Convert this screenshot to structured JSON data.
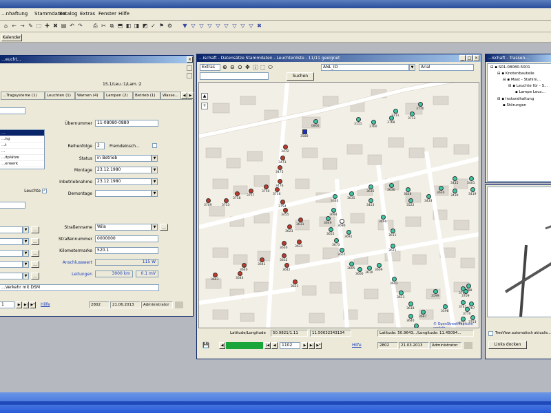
{
  "menu": {
    "items": [
      "...nhaftung",
      "Stammdaten",
      "Katalog",
      "Extras",
      "Fenster",
      "Hilfe"
    ]
  },
  "toolbar2": {
    "label": "Kalender"
  },
  "left_window": {
    "title": "...eucht...",
    "counter": "1S.1/Leu.:1/Lam.:2",
    "tabs": [
      "...Tragsysteme (1)",
      "Leuchten (1)",
      "Warnen (4)",
      "Lampen (2)",
      "Betrieb (1)",
      "Wasse..."
    ],
    "fields": {
      "uebernummer_label": "Übernummer",
      "uebernummer": "11-08080-0880",
      "reihenfolge_label": "Reihenfolge",
      "reihenfolge": "2",
      "fremdeinspeisung_label": "Fremdeinsch...",
      "status_label": "Status",
      "status": "in Betrieb",
      "montage_label": "Montage",
      "montage": "23.12.1980",
      "inbetriebnahme_label": "Inbetriebnahme",
      "inbetriebnahme": "23.12.1980",
      "demontage_label": "Demontage",
      "demontage": "",
      "strassenname_label": "Straßenname",
      "strassenname": "Wila",
      "strassennummer_label": "Straßennummer",
      "strassennummer": "0000000",
      "kilometermarke_label": "Kilometermarke",
      "kilometermarke": "520.1",
      "anschlusswert_label": "Anschlusswert",
      "anschlusswert": "115 W",
      "leitungen_label": "Leitungen",
      "leitungen": "3000 km",
      "leitungen_b": "0.1 mV",
      "checkbox_label": "Leuchte",
      "bottom_text": "...Verkehr mit DSM",
      "small_box": "0"
    },
    "list_items": [
      "...",
      "...ng",
      "...t",
      "...",
      "...itplätze",
      "...erwerk"
    ],
    "status": {
      "page": "1",
      "hilfe": "Hilfe",
      "c1": "2802",
      "c2": "21.06.2013",
      "c3": "Administrator"
    }
  },
  "map_window": {
    "title": "...ischaft - Datensätze Stammdaten - Leuchtenliste - 11/11 geeignet",
    "zoom": "Extras",
    "layer_select": "ANL_ID",
    "font_select": "Arial",
    "search_button": "Suchen",
    "coord_label_1": "Latitude/Longitude",
    "coord_1": "50.9821/1.11",
    "coord_2": "11.50632343134",
    "coord_right": "Latitude: 50.9643.../Longitude: 11.45094...",
    "credit": "© OpenStreetMap.com contrib.",
    "status": {
      "progress": "...",
      "page": "1102",
      "hilfe": "Hilfe",
      "c1": "2802",
      "c2": "21.03.2013",
      "c3": "Administrator"
    },
    "markers": [
      {
        "id": "0806",
        "type": "teal"
      },
      {
        "id": "3151",
        "type": "teal"
      },
      {
        "id": "3760",
        "type": "teal"
      },
      {
        "id": "3768",
        "type": "teal"
      },
      {
        "id": "3711",
        "type": "teal"
      },
      {
        "id": "3712",
        "type": "teal"
      },
      {
        "id": "3770",
        "type": "teal"
      },
      {
        "id": "3580",
        "type": "blue"
      },
      {
        "id": "3472",
        "type": "red"
      },
      {
        "id": "3473",
        "type": "red"
      },
      {
        "id": "3475",
        "type": "red"
      },
      {
        "id": "3476",
        "type": "red"
      },
      {
        "id": "3750",
        "type": "red"
      },
      {
        "id": "3757",
        "type": "red"
      },
      {
        "id": "3758",
        "type": "red"
      },
      {
        "id": "3709",
        "type": "red"
      },
      {
        "id": "3753",
        "type": "red"
      },
      {
        "id": "3756",
        "type": "red"
      },
      {
        "id": "3754",
        "type": "red"
      },
      {
        "id": "3455",
        "type": "red"
      },
      {
        "id": "3623",
        "type": "red"
      },
      {
        "id": "3631",
        "type": "red"
      },
      {
        "id": "3630",
        "type": "red"
      },
      {
        "id": "3631b",
        "type": "red"
      },
      {
        "id": "3632",
        "type": "red"
      },
      {
        "id": "3641",
        "type": "red"
      },
      {
        "id": "3640",
        "type": "red"
      },
      {
        "id": "3643",
        "type": "red"
      },
      {
        "id": "3644",
        "type": "red"
      },
      {
        "id": "3642",
        "type": "red"
      },
      {
        "id": "3621",
        "type": "red"
      },
      {
        "id": "3633",
        "type": "teal"
      },
      {
        "id": "3635",
        "type": "teal"
      },
      {
        "id": "3635b",
        "type": "teal"
      },
      {
        "id": "3636",
        "type": "teal"
      },
      {
        "id": "3628",
        "type": "teal"
      },
      {
        "id": "3522",
        "type": "teal"
      },
      {
        "id": "3433",
        "type": "teal"
      },
      {
        "id": "3630b",
        "type": "teal"
      },
      {
        "id": "3430",
        "type": "teal"
      },
      {
        "id": "3419",
        "type": "teal"
      },
      {
        "id": "3415",
        "type": "teal"
      },
      {
        "id": "3401",
        "type": "teal"
      },
      {
        "id": "3453",
        "type": "teal"
      },
      {
        "id": "3469",
        "type": "teal"
      },
      {
        "id": "3611",
        "type": "teal"
      },
      {
        "id": "3621b",
        "type": "teal"
      },
      {
        "id": "3694",
        "type": "teal"
      },
      {
        "id": "3649",
        "type": "teal"
      },
      {
        "id": "3655",
        "type": "teal"
      },
      {
        "id": "3673",
        "type": "teal"
      },
      {
        "id": "3607",
        "type": "teal"
      },
      {
        "id": "3605",
        "type": "teal"
      },
      {
        "id": "3606",
        "type": "teal"
      },
      {
        "id": "3610",
        "type": "teal"
      },
      {
        "id": "3609",
        "type": "teal"
      },
      {
        "id": "3603",
        "type": "teal"
      },
      {
        "id": "3613",
        "type": "teal"
      },
      {
        "id": "3618",
        "type": "teal"
      },
      {
        "id": "3640b",
        "type": "teal"
      },
      {
        "id": "3677",
        "type": "teal"
      },
      {
        "id": "3687",
        "type": "teal"
      },
      {
        "id": "3599",
        "type": "teal"
      },
      {
        "id": "3598",
        "type": "teal"
      },
      {
        "id": "3765",
        "type": "teal"
      },
      {
        "id": "3698",
        "type": "teal"
      },
      {
        "id": "3741",
        "type": "teal"
      },
      {
        "id": "3767",
        "type": "teal"
      },
      {
        "id": "3753b",
        "type": "teal"
      },
      {
        "id": "3771",
        "type": "teal"
      },
      {
        "id": "3709b",
        "type": "teal"
      },
      {
        "id": "3770b",
        "type": "teal"
      },
      {
        "id": "3690",
        "type": "white"
      },
      {
        "id": "3691",
        "type": "teal"
      }
    ]
  },
  "tree_window": {
    "title": "...ischaft - Trassen...",
    "items": [
      "S01-08080-5001",
      "Knotenbauteile",
      "Mast - Stahlm...",
      "Leuchte für - S...",
      "Lampe Leuc...",
      "Instandhaltung",
      "Störungen"
    ],
    "checkbox_label": "TreeView automatisch aktualis...",
    "button": "Links docken"
  },
  "colors": {
    "title_from": "#0a246a",
    "title_to": "#a6caf0",
    "marker_red": "#c0392b",
    "marker_teal": "#3ec7a7",
    "map_bg": "#f2efe6",
    "building": "#dcd8cf"
  }
}
